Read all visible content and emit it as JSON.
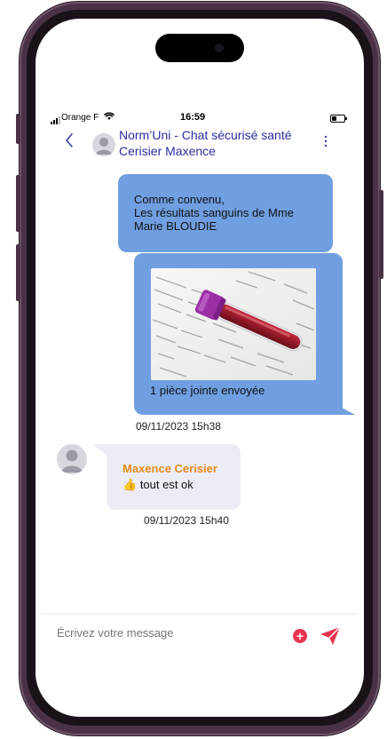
{
  "status_bar": {
    "carrier": "Orange F",
    "wifi_icon": "wifi-icon",
    "time": "16:59",
    "battery_icon": "battery-icon"
  },
  "header": {
    "title": "Norm’Uni - Chat sécurisé santé",
    "subtitle": "Cerisier Maxence"
  },
  "messages": [
    {
      "direction": "outgoing",
      "lines": [
        "Comme convenu,",
        "Les résultats sanguins de Mme",
        "Marie BLOUDIE"
      ]
    },
    {
      "direction": "outgoing",
      "attachment_caption": "1 pièce jointe envoyée",
      "timestamp": "09/11/2023 15h38"
    },
    {
      "direction": "incoming",
      "sender": "Maxence Cerisier",
      "emoji": "👍",
      "text": "tout est ok",
      "timestamp": "09/11/2023 15h40"
    }
  ],
  "composer": {
    "placeholder": "Écrivez votre message"
  },
  "colors": {
    "outgoing_bubble": "#6f9fe0",
    "incoming_bubble": "#ececf5",
    "header_text": "#2a2ea0",
    "sender_name": "#e58b1e",
    "add_button": "#e8344f",
    "send_button": "#e8344f",
    "frame": "#4a3146"
  }
}
